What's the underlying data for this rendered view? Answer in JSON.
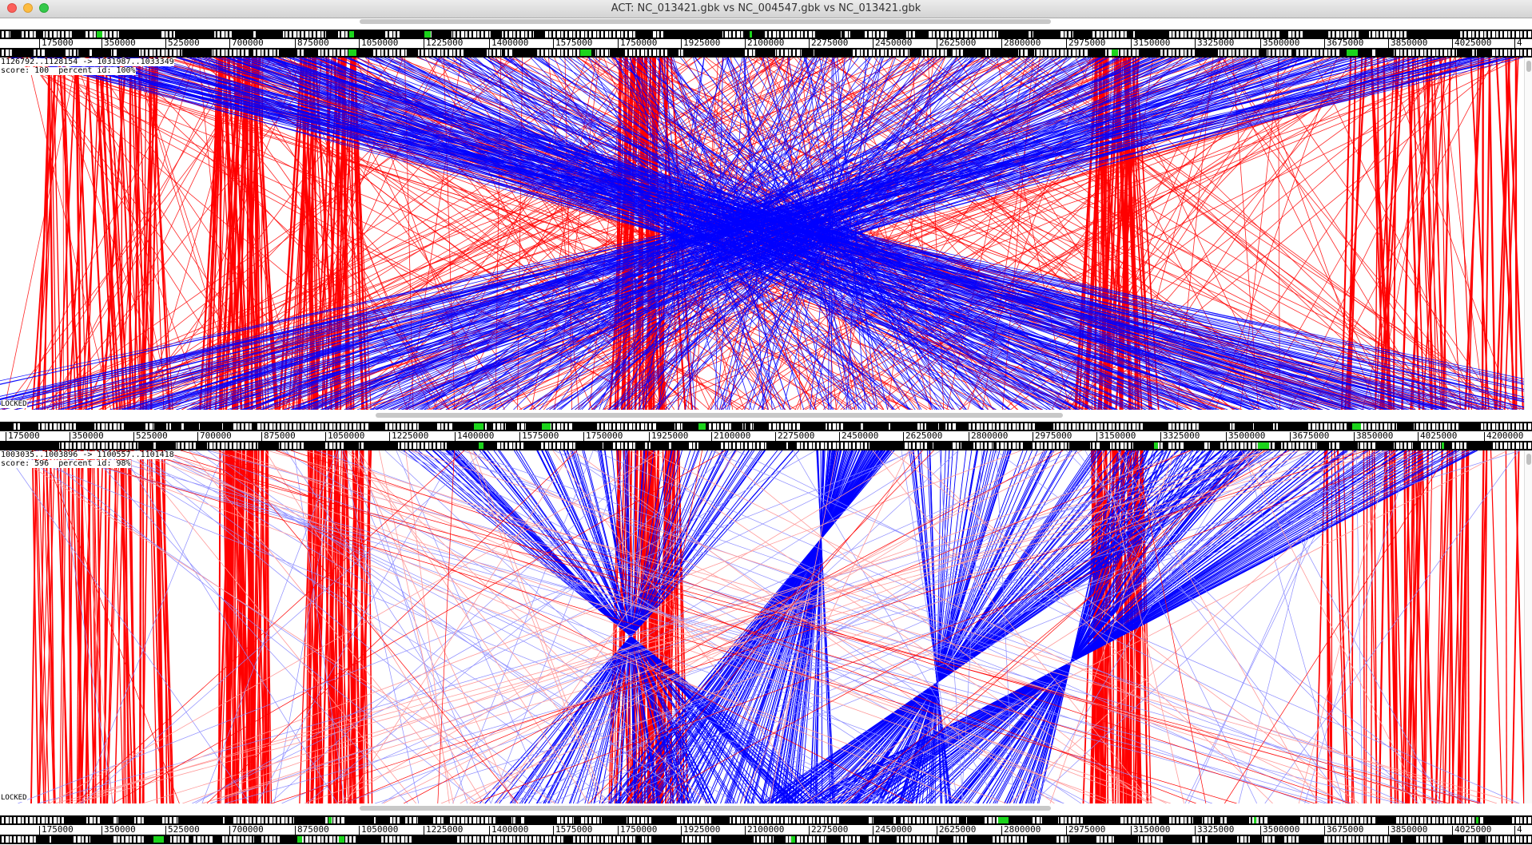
{
  "window": {
    "title": "ACT: NC_013421.gbk vs NC_004547.gbk vs NC_013421.gbk"
  },
  "genome_panels": [
    {
      "name": "NC_013421 top",
      "ticks": [
        "175000",
        "350000",
        "525000",
        "700000",
        "875000",
        "1050000",
        "1225000",
        "1400000",
        "1575000",
        "1750000",
        "1925000",
        "2100000",
        "2275000",
        "2450000",
        "2625000",
        "2800000",
        "2975000",
        "3150000",
        "3325000",
        "3500000",
        "3675000",
        "3850000",
        "4025000",
        "4"
      ]
    },
    {
      "name": "NC_004547 middle",
      "ticks": [
        "175000",
        "350000",
        "525000",
        "700000",
        "875000",
        "1050000",
        "1225000",
        "1400000",
        "1575000",
        "1750000",
        "1925000",
        "2100000",
        "2275000",
        "2450000",
        "2625000",
        "2800000",
        "2975000",
        "3150000",
        "3325000",
        "3500000",
        "3675000",
        "3850000",
        "4025000",
        "4200000"
      ]
    },
    {
      "name": "NC_013421 bottom",
      "ticks": [
        "175000",
        "350000",
        "525000",
        "700000",
        "875000",
        "1050000",
        "1225000",
        "1400000",
        "1575000",
        "1750000",
        "1925000",
        "2100000",
        "2275000",
        "2450000",
        "2625000",
        "2800000",
        "2975000",
        "3150000",
        "3325000",
        "3500000",
        "3675000",
        "3850000",
        "4025000",
        "4"
      ]
    }
  ],
  "comparisons": [
    {
      "match_range": "1126792..1128154 -> 1031987..1033349",
      "score_line": "score: 100  percent id: 100%",
      "lock_label": "LOCKED"
    },
    {
      "match_range": "1003035..1003896 -> 1100557..1101418",
      "score_line": "score: 596  percent id: 98%",
      "lock_label": "LOCKED"
    }
  ],
  "colors": {
    "direct_match": "#ff0000",
    "inverted_match": "#0000ff",
    "weak_direct": "#ff9a9a",
    "weak_inverted": "#8c8cff",
    "feature_green": "#1bd41b"
  }
}
